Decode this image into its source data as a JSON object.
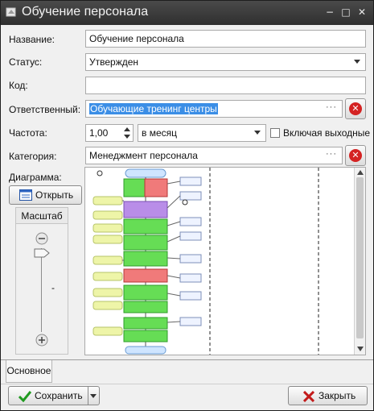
{
  "window": {
    "title": "Обучение персонала"
  },
  "form": {
    "name_label": "Название:",
    "name_value": "Обучение персонала",
    "status_label": "Статус:",
    "status_value": "Утвержден",
    "code_label": "Код:",
    "code_value": "",
    "responsible_label": "Ответственный:",
    "responsible_value": "Обучающие тренинг центры",
    "frequency_label": "Частота:",
    "frequency_value": "1,00",
    "frequency_unit": "в месяц",
    "weekends_label": "Включая выходные",
    "weekends_checked": false,
    "category_label": "Категория:",
    "category_value": "Менеджмент персонала",
    "diagram_label": "Диаграмма:"
  },
  "diagram_panel": {
    "open_button": "Открыть",
    "scale_label": "Масштаб",
    "scale_dash": "-"
  },
  "tabs": [
    {
      "label": "Основное"
    }
  ],
  "footer": {
    "save_button": "Сохранить",
    "close_button": "Закрыть"
  },
  "colors": {
    "titlebar": "#353535",
    "selection": "#3b8ee6",
    "clear_red": "#d42222",
    "node_green": "#66dd55",
    "node_red": "#f07a7a",
    "node_purple": "#b98de8",
    "note_yellow": "#eef5a8",
    "start_blue": "#cfe5ff"
  }
}
